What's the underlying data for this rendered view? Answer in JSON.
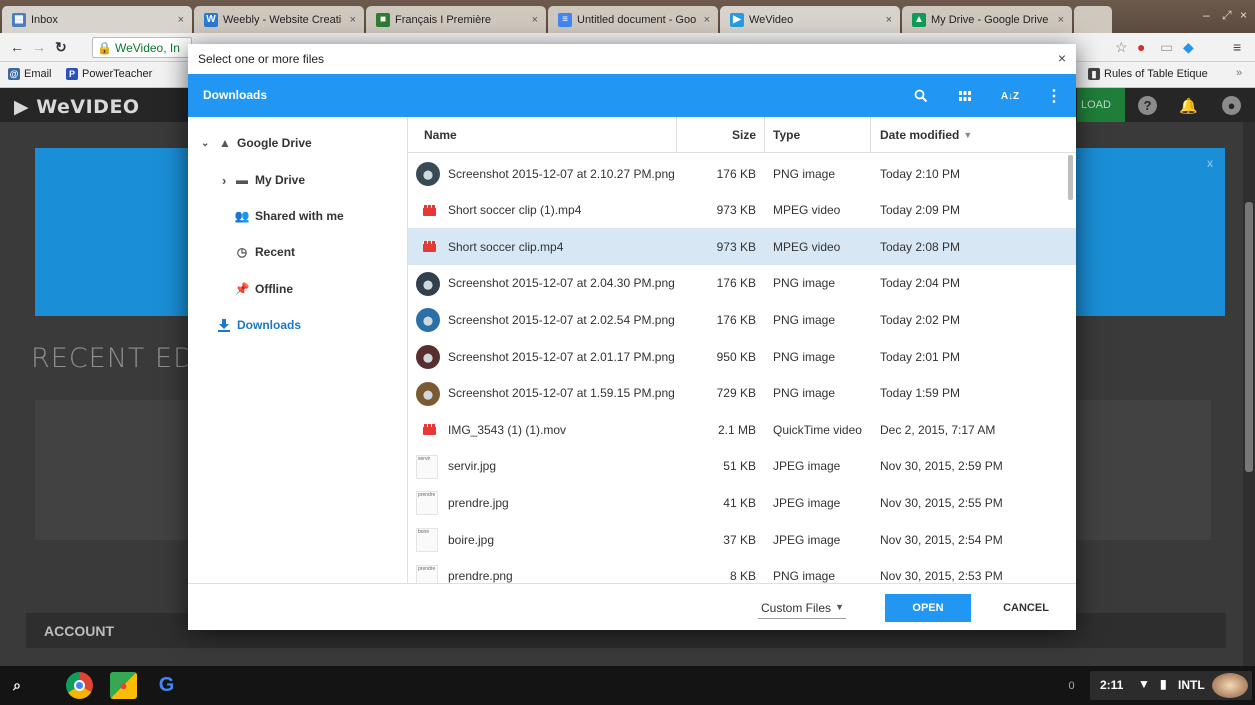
{
  "browser": {
    "tabs": [
      {
        "title": "Inbox",
        "favicon": "inbox-icon",
        "color": "#4a7ec0"
      },
      {
        "title": "Weebly - Website Creati",
        "favicon": "weebly-icon",
        "color": "#2a7ad2"
      },
      {
        "title": "Français I Première",
        "favicon": "classroom-icon",
        "color": "#2e7d32"
      },
      {
        "title": "Untitled document - Goo",
        "favicon": "docs-icon",
        "color": "#4285f4"
      },
      {
        "title": "WeVideo",
        "favicon": "wevideo-icon",
        "color": "#2b9be0"
      },
      {
        "title": "My Drive - Google Drive",
        "favicon": "drive-icon",
        "color": "#0f9d58"
      }
    ],
    "omnibox_text": "WeVideo, In",
    "bookmarks": [
      {
        "label": "Email",
        "icon": "email-icon"
      },
      {
        "label": "PowerTeacher",
        "icon": "powerteacher-icon"
      },
      {
        "label": "Rules of Table Etique",
        "icon": "bookmark-doc-icon"
      }
    ]
  },
  "wevideo": {
    "logo": "WeVIDEO",
    "upload_label": "LOAD",
    "banner_close": "x",
    "recent_edits": "RECENT EDIT",
    "account": "ACCOUNT"
  },
  "dialog": {
    "title": "Select one or more files",
    "location": "Downloads",
    "sidebar": [
      {
        "label": "Google Drive",
        "icon": "drive-icon",
        "chevron": "⌄"
      },
      {
        "label": "My Drive",
        "icon": "folder-icon",
        "chevron": "›"
      },
      {
        "label": "Shared with me",
        "icon": "people-icon",
        "chevron": ""
      },
      {
        "label": "Recent",
        "icon": "clock-icon",
        "chevron": ""
      },
      {
        "label": "Offline",
        "icon": "pin-icon",
        "chevron": ""
      },
      {
        "label": "Downloads",
        "icon": "download-icon",
        "chevron": ""
      }
    ],
    "columns": {
      "name": "Name",
      "size": "Size",
      "type": "Type",
      "date": "Date modified"
    },
    "files": [
      {
        "name": "Screenshot 2015-12-07 at 2.10.27 PM.png",
        "size": "176 KB",
        "type": "PNG image",
        "date": "Today 2:10 PM",
        "kind": "png",
        "thumb": "#3a4a55"
      },
      {
        "name": "Short soccer clip (1).mp4",
        "size": "973 KB",
        "type": "MPEG video",
        "date": "Today 2:09 PM",
        "kind": "video",
        "thumb": ""
      },
      {
        "name": "Short soccer clip.mp4",
        "size": "973 KB",
        "type": "MPEG video",
        "date": "Today 2:08 PM",
        "kind": "video",
        "thumb": ""
      },
      {
        "name": "Screenshot 2015-12-07 at 2.04.30 PM.png",
        "size": "176 KB",
        "type": "PNG image",
        "date": "Today 2:04 PM",
        "kind": "png",
        "thumb": "#30404c"
      },
      {
        "name": "Screenshot 2015-12-07 at 2.02.54 PM.png",
        "size": "176 KB",
        "type": "PNG image",
        "date": "Today 2:02 PM",
        "kind": "png",
        "thumb": "#2a6fa8"
      },
      {
        "name": "Screenshot 2015-12-07 at 2.01.17 PM.png",
        "size": "950 KB",
        "type": "PNG image",
        "date": "Today 2:01 PM",
        "kind": "png",
        "thumb": "#5a2e2e"
      },
      {
        "name": "Screenshot 2015-12-07 at 1.59.15 PM.png",
        "size": "729 KB",
        "type": "PNG image",
        "date": "Today 1:59 PM",
        "kind": "png",
        "thumb": "#7a5a30"
      },
      {
        "name": "IMG_3543 (1) (1).mov",
        "size": "2.1 MB",
        "type": "QuickTime video",
        "date": "Dec 2, 2015, 7:17 AM",
        "kind": "video",
        "thumb": ""
      },
      {
        "name": "servir.jpg",
        "size": "51 KB",
        "type": "JPEG image",
        "date": "Nov 30, 2015, 2:59 PM",
        "kind": "jpg",
        "thumb": "servir"
      },
      {
        "name": "prendre.jpg",
        "size": "41 KB",
        "type": "JPEG image",
        "date": "Nov 30, 2015, 2:55 PM",
        "kind": "jpg",
        "thumb": "prendre"
      },
      {
        "name": "boire.jpg",
        "size": "37 KB",
        "type": "JPEG image",
        "date": "Nov 30, 2015, 2:54 PM",
        "kind": "jpg",
        "thumb": "boire"
      },
      {
        "name": "prendre.png",
        "size": "8 KB",
        "type": "PNG image",
        "date": "Nov 30, 2015, 2:53 PM",
        "kind": "jpg",
        "thumb": "prendre"
      }
    ],
    "selected_file": "Short soccer clip.mp4",
    "filter": "Custom Files",
    "open_label": "OPEN",
    "cancel_label": "CANCEL",
    "close_label": "×"
  },
  "shelf": {
    "apps": [
      "search-icon",
      "chrome-icon",
      "maps-icon",
      "google-icon"
    ],
    "notification_count": "0",
    "clock": "2:11",
    "input_method": "INTL"
  },
  "colors": {
    "accent": "#2196f3",
    "selected_row": "#d7e8f4",
    "wevideo_banner": "#1a8ed6",
    "upload_green": "#1f7f3a"
  }
}
